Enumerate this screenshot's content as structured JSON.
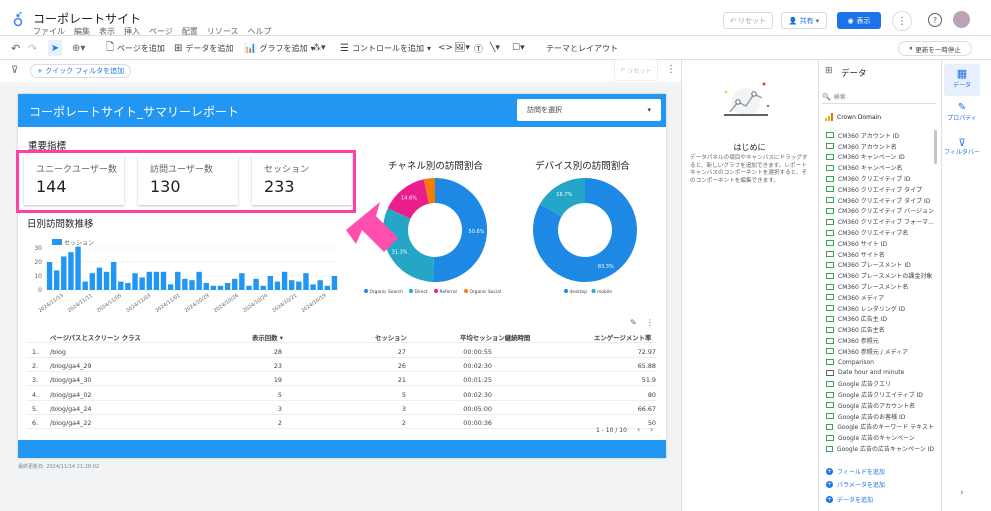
{
  "app": {
    "title": "コーポレートサイト",
    "menu": [
      "ファイル",
      "編集",
      "表示",
      "挿入",
      "ページ",
      "配置",
      "リソース",
      "ヘルプ"
    ],
    "reset_label": "リセット",
    "share_label": "共有",
    "view_label": "表示",
    "pause_label": "更新を一時停止"
  },
  "toolbar": {
    "add_page": "ページを追加",
    "add_data": "データを追加",
    "add_chart": "グラフを追加",
    "add_control": "コントロールを追加",
    "theme_layout": "テーマとレイアウト"
  },
  "filterbar": {
    "quick_filter": "+ クイック フィルタを追加",
    "reset_label": "リセット"
  },
  "report": {
    "title": "コーポレートサイト_サマリーレポート",
    "visit_select": "訪問を選択",
    "kpi_heading": "重要指標",
    "kpis": [
      {
        "label": "ユニークユーザー数",
        "value": "144"
      },
      {
        "label": "訪問ユーザー数",
        "value": "130"
      },
      {
        "label": "セッション",
        "value": "233"
      }
    ],
    "daily_heading": "日別訪問数推移",
    "daily_legend": "セッション",
    "channel_heading": "チャネル別の訪問割合",
    "device_heading": "デバイス別の訪問割合",
    "footer": "最終更新日: 2024/11/14 21:28:02"
  },
  "chart_data": [
    {
      "type": "bar",
      "title": "日別訪問数推移",
      "series": [
        {
          "name": "セッション",
          "values": [
            20,
            14,
            24,
            27,
            31,
            6,
            12,
            16,
            13,
            20,
            6,
            5,
            12,
            9,
            13,
            13,
            13,
            4,
            13,
            8,
            7,
            13,
            5,
            3,
            3,
            5,
            8,
            12,
            3,
            8,
            3,
            10,
            6,
            13,
            7,
            6,
            12,
            4,
            7,
            3,
            10
          ]
        }
      ],
      "ylim": [
        0,
        30
      ],
      "yticks": [
        0,
        10,
        20,
        30
      ],
      "x_tick_labels": [
        "2024/11/13",
        "2024/11/11",
        "2024/11/05",
        "2024/11/03",
        "2024/11/01",
        "2024/10/29",
        "2024/10/26",
        "2024/10/24",
        "2024/10/21",
        "2024/10/19"
      ]
    },
    {
      "type": "pie",
      "title": "チャネル別の訪問割合",
      "categories": [
        "Organic Search",
        "Direct",
        "Referral",
        "Organic Social"
      ],
      "values": [
        50.6,
        31.3,
        14.6,
        3.5
      ],
      "colors": [
        "#1e88e5",
        "#26a6c6",
        "#e91e8c",
        "#f57c00"
      ],
      "data_labels": [
        "50.6%",
        "31.3%",
        "14.6%",
        ""
      ]
    },
    {
      "type": "pie",
      "title": "デバイス別の訪問割合",
      "categories": [
        "desktop",
        "mobile"
      ],
      "values": [
        83.3,
        16.7
      ],
      "colors": [
        "#1e88e5",
        "#26a6c6"
      ],
      "data_labels": [
        "83.3%",
        "16.7%"
      ]
    },
    {
      "type": "table",
      "columns": [
        "ページパスとスクリーン クラス",
        "表示回数",
        "セッション",
        "平均セッション継続時間",
        "エンゲージメント率"
      ],
      "rows": [
        [
          "1.",
          "/blog",
          "28",
          "27",
          "00:00:55",
          "72.97"
        ],
        [
          "2.",
          "/blog/ga4_29",
          "23",
          "26",
          "00:02:30",
          "65.88"
        ],
        [
          "3.",
          "/blog/ga4_30",
          "19",
          "21",
          "00:01:25",
          "51.9"
        ],
        [
          "4.",
          "/blog/ga4_02",
          "5",
          "5",
          "00:02:30",
          "80"
        ],
        [
          "5.",
          "/blog/ga4_24",
          "3",
          "3",
          "00:05:00",
          "66.67"
        ],
        [
          "6.",
          "/blog/ga4_22",
          "2",
          "2",
          "00:00:36",
          "50"
        ]
      ],
      "pagination": "1 - 10 / 10"
    }
  ],
  "sidepanel": {
    "intro_title": "はじめに",
    "intro_text": "データパネルの項目やキャンバスにドラッグすると、新しいグラフを追加できます。レポート キャンバスのコンポーネントを選択すると、そのコンポーネントを編集できます。",
    "data_title": "データ",
    "search_placeholder": "検索",
    "source": "Crown Domain",
    "fields": [
      "CM360 アカウント ID",
      "CM360 アカウント名",
      "CM360 キャンペーン ID",
      "CM360 キャンペーン名",
      "CM360 クリエイティブ ID",
      "CM360 クリエイティブ タイプ",
      "CM360 クリエイティブ タイプ ID",
      "CM360 クリエイティブ バージョン",
      "CM360 クリエイティブ フォーマ…",
      "CM360 クリエイティブ名",
      "CM360 サイト ID",
      "CM360 サイト名",
      "CM360 プレースメント ID",
      "CM360 プレースメントの課金対象",
      "CM360 プレースメント名",
      "CM360 メディア",
      "CM360 レンダリング ID",
      "CM360 広告主 ID",
      "CM360 広告主名",
      "CM360 参照元",
      "CM360 参照元 / メディア",
      "Comparison",
      "Date hour and minute",
      "Google 広告クエリ",
      "Google 広告クリエイティブ ID",
      "Google 広告のアカウント名",
      "Google 広告のお客様 ID",
      "Google 広告のキーワード テキスト",
      "Google 広告のキャンペーン",
      "Google 広告の広告キャンペーン ID"
    ],
    "add_field": "フィールドを追加",
    "add_param": "パラメータを追加",
    "add_data": "データを追加",
    "tabs": [
      "データ",
      "プロパティ",
      "フィルタバー"
    ]
  }
}
